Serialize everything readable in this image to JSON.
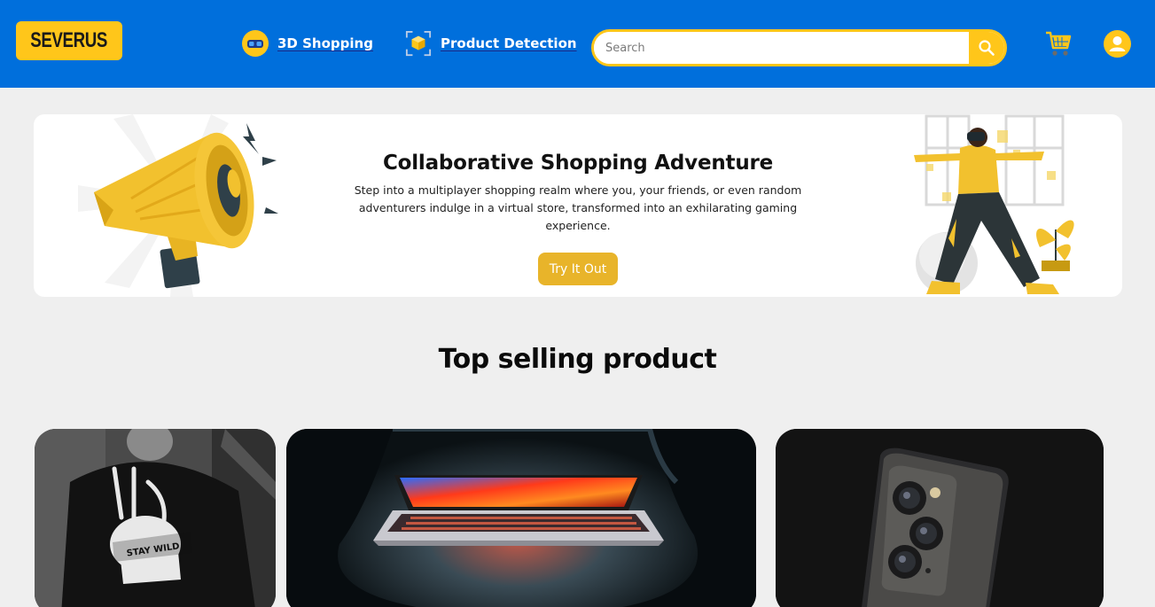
{
  "header": {
    "logo_text": "SEVERUS",
    "nav": [
      {
        "label": "3D Shopping",
        "icon": "vr-headset-icon"
      },
      {
        "label": "Product Detection",
        "icon": "product-scan-icon"
      }
    ],
    "search": {
      "placeholder": "Search",
      "value": ""
    },
    "cart_icon": "cart-icon",
    "user_icon": "user-icon"
  },
  "hero": {
    "title": "Collaborative Shopping Adventure",
    "description": "Step into a multiplayer shopping realm where you, your friends, or even random adventurers indulge in a virtual store, transformed into an exhilarating gaming experience.",
    "cta_label": "Try It Out"
  },
  "top_selling": {
    "title": "Top selling product",
    "products": [
      {
        "name": "tshirt",
        "print_text": "STAY WILD"
      },
      {
        "name": "laptop"
      },
      {
        "name": "phone"
      }
    ]
  },
  "colors": {
    "header_bg": "#006fdc",
    "accent": "#ffc61a",
    "cta": "#e8b42a",
    "page_bg": "#efefef"
  }
}
